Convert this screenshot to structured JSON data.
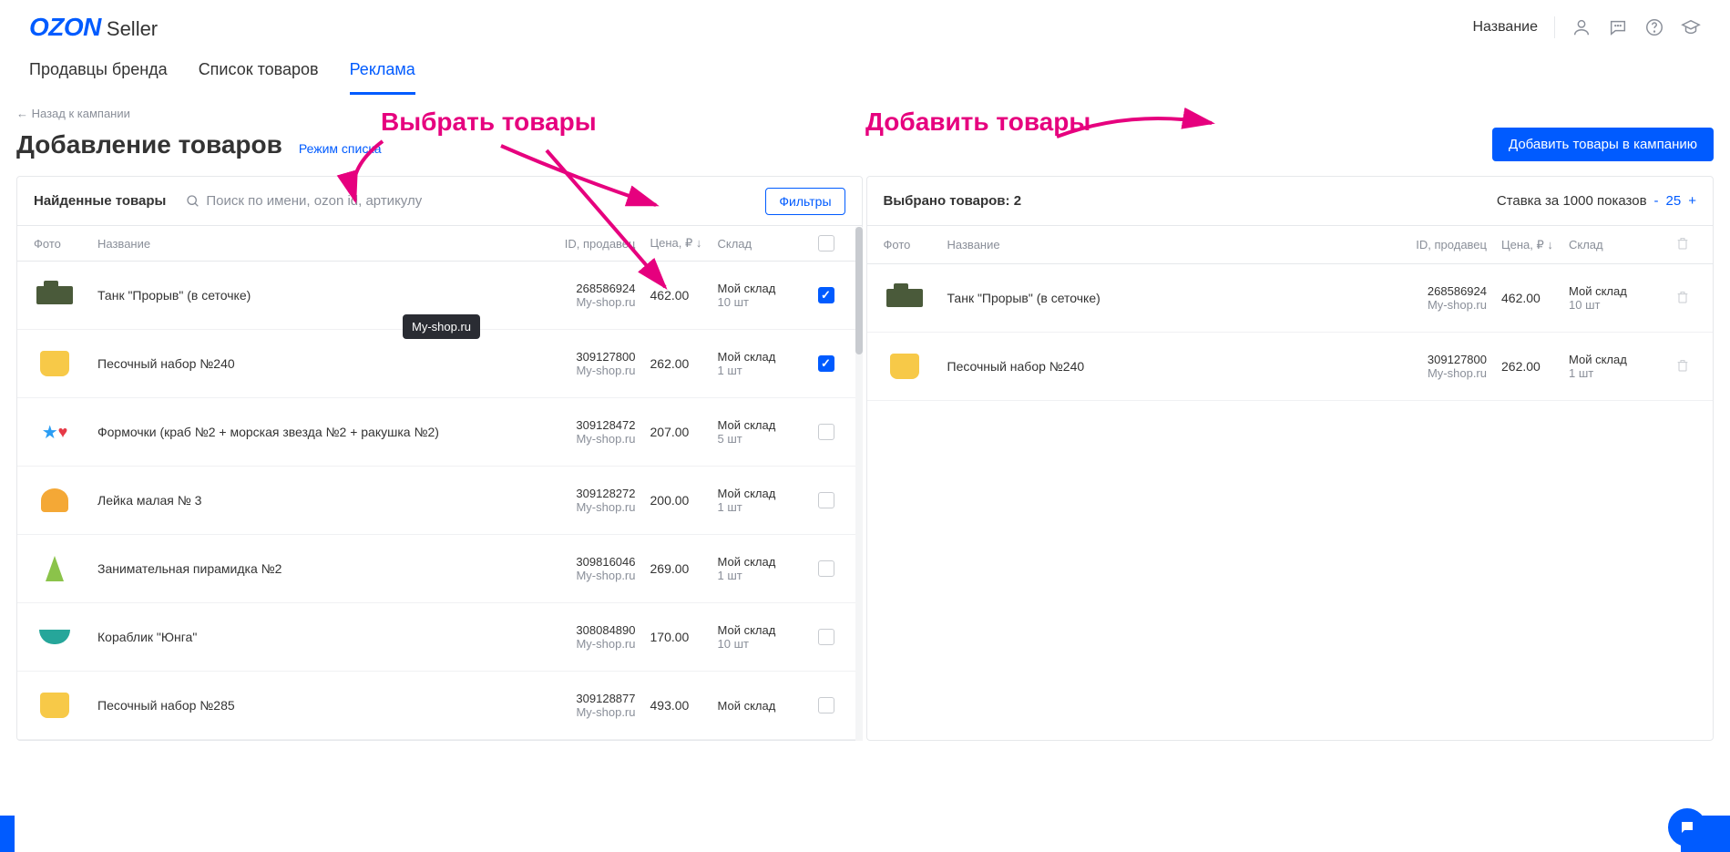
{
  "header": {
    "logo_brand": "OZON",
    "logo_sub": "Seller",
    "right_label": "Название"
  },
  "nav": {
    "items": [
      "Продавцы бренда",
      "Список товаров",
      "Реклама"
    ],
    "active_index": 2
  },
  "back_link": "← Назад к кампании",
  "page_title": "Добавление товаров",
  "mode_link": "Режим списка",
  "add_button": "Добавить товары в кампанию",
  "annotations": {
    "select": "Выбрать товары",
    "add": "Добавить товары"
  },
  "left": {
    "title": "Найденные товары",
    "search_placeholder": "Поиск по имени, ozon id, артикулу",
    "filter_btn": "Фильтры",
    "cols": {
      "photo": "Фото",
      "name": "Название",
      "id": "ID, продавец",
      "price": "Цена, ₽ ↓",
      "stock": "Склад"
    },
    "rows": [
      {
        "name": "Танк \"Прорыв\" (в сеточке)",
        "id": "268586924",
        "seller": "My-shop.ru",
        "price": "462.00",
        "stock": "Мой склад",
        "qty": "10 шт",
        "checked": true,
        "icon": "tank"
      },
      {
        "name": "Песочный набор №240",
        "id": "309127800",
        "seller": "My-shop.ru",
        "price": "262.00",
        "stock": "Мой склад",
        "qty": "1 шт",
        "checked": true,
        "icon": "sand"
      },
      {
        "name": "Формочки (краб №2 + морская звезда №2 + ракушка №2)",
        "id": "309128472",
        "seller": "My-shop.ru",
        "price": "207.00",
        "stock": "Мой склад",
        "qty": "5 шт",
        "checked": false,
        "icon": "shapes"
      },
      {
        "name": "Лейка малая № 3",
        "id": "309128272",
        "seller": "My-shop.ru",
        "price": "200.00",
        "stock": "Мой склад",
        "qty": "1 шт",
        "checked": false,
        "icon": "can"
      },
      {
        "name": "Занимательная пирамидка №2",
        "id": "309816046",
        "seller": "My-shop.ru",
        "price": "269.00",
        "stock": "Мой склад",
        "qty": "1 шт",
        "checked": false,
        "icon": "pyr"
      },
      {
        "name": "Кораблик \"Юнга\"",
        "id": "308084890",
        "seller": "My-shop.ru",
        "price": "170.00",
        "stock": "Мой склад",
        "qty": "10 шт",
        "checked": false,
        "icon": "boat"
      },
      {
        "name": "Песочный набор №285",
        "id": "309128877",
        "seller": "My-shop.ru",
        "price": "493.00",
        "stock": "Мой склад",
        "qty": "",
        "checked": false,
        "icon": "sand"
      }
    ]
  },
  "tooltip": "My-shop.ru",
  "right": {
    "title": "Выбрано товаров: 2",
    "rate_label": "Ставка за 1000 показов",
    "rate_value": "25",
    "cols": {
      "photo": "Фото",
      "name": "Название",
      "id": "ID, продавец",
      "price": "Цена, ₽ ↓",
      "stock": "Склад"
    },
    "rows": [
      {
        "name": "Танк \"Прорыв\" (в сеточке)",
        "id": "268586924",
        "seller": "My-shop.ru",
        "price": "462.00",
        "stock": "Мой склад",
        "qty": "10 шт",
        "icon": "tank"
      },
      {
        "name": "Песочный набор №240",
        "id": "309127800",
        "seller": "My-shop.ru",
        "price": "262.00",
        "stock": "Мой склад",
        "qty": "1 шт",
        "icon": "sand"
      }
    ]
  }
}
